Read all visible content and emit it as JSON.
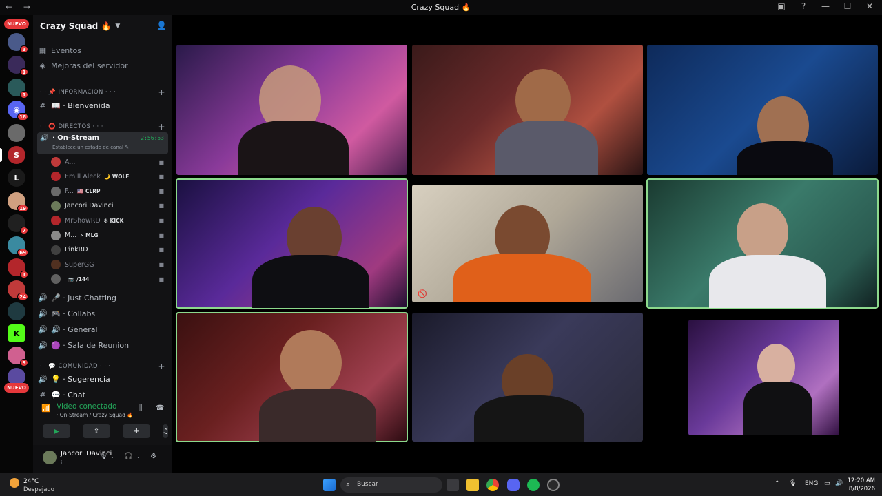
{
  "window": {
    "title": "Crazy Squad 🔥",
    "nav": "← →",
    "buttons": [
      "▣",
      "?",
      "—",
      "☐",
      "✕"
    ]
  },
  "rail": {
    "new_label_top": "NUEVO",
    "new_label_bottom": "NUEVO",
    "servers": [
      {
        "name": "server-1",
        "color": "#4a5a8a",
        "badge": "3"
      },
      {
        "name": "server-2",
        "color": "#3a2a5a",
        "badge": "1"
      },
      {
        "name": "server-3",
        "color": "#2a5a5a",
        "badge": "1"
      },
      {
        "name": "server-4",
        "color": "#5865f2",
        "badge": "18",
        "letter": "◉"
      },
      {
        "name": "server-5",
        "color": "#6a6a6a",
        "badge": ""
      },
      {
        "name": "server-6",
        "color": "#b3262b",
        "badge": "",
        "letter": "S"
      },
      {
        "name": "server-7",
        "color": "#1a1a1a",
        "badge": "",
        "letter": "L"
      },
      {
        "name": "server-8",
        "color": "#d0a080",
        "badge": "19"
      },
      {
        "name": "server-9",
        "color": "#202020",
        "badge": "7"
      },
      {
        "name": "server-10",
        "color": "#3a8aa0",
        "badge": "69"
      },
      {
        "name": "server-11",
        "color": "#b3262b",
        "badge": "1"
      },
      {
        "name": "server-12",
        "color": "#c03a3a",
        "badge": "24"
      },
      {
        "name": "server-13",
        "color": "#1f3a40",
        "badge": ""
      },
      {
        "name": "server-14",
        "color": "#53fc18",
        "badge": "",
        "letter": "K"
      },
      {
        "name": "server-15",
        "color": "#d06090",
        "badge": "9"
      },
      {
        "name": "server-16",
        "color": "#5a4aa0",
        "badge": ""
      }
    ]
  },
  "sidebar": {
    "server_name": "Crazy Squad 🔥",
    "top_items": [
      {
        "label": "Eventos",
        "icon": "▦"
      },
      {
        "label": "Mejoras del servidor",
        "icon": "◈"
      }
    ],
    "categories": {
      "info": "· · 📌 INFORMACION · · ·",
      "directos": "· · ⭕ DIRECTOS · · ·",
      "comunidad": "· · 💬 COMUNIDAD · · ·"
    },
    "bienvenida": "📖 · Bienvenida",
    "active_channel": {
      "name": "· On-Stream",
      "timer": "2:56:53",
      "status": "Establece un estado de canal ✎"
    },
    "users": [
      {
        "name": "A...",
        "tag": "",
        "color": "#c03a3a",
        "bright": false
      },
      {
        "name": "Emill Aleck",
        "tag": "🌙 WOLF",
        "color": "#b3262b",
        "bright": false
      },
      {
        "name": "F...",
        "tag": "🇺🇸 CLRP",
        "color": "#6a6a6a",
        "bright": false
      },
      {
        "name": "Jancori Davinci",
        "tag": "",
        "color": "#6b7a5a",
        "bright": true
      },
      {
        "name": "MrShowRD",
        "tag": "❇ KICK",
        "color": "#b3262b",
        "bright": false
      },
      {
        "name": "M...",
        "tag": "⚡ MLG",
        "color": "#8a8a8a",
        "bright": true
      },
      {
        "name": "PinkRD",
        "tag": "",
        "color": "#404040",
        "bright": true
      },
      {
        "name": "SuperGG",
        "tag": "",
        "color": "#503020",
        "bright": false
      },
      {
        "name": "",
        "tag": "📷 /144",
        "color": "#606060",
        "bright": true
      }
    ],
    "voice_channels": [
      {
        "label": "🎤 · Just Chatting"
      },
      {
        "label": "🎮 · Collabs"
      },
      {
        "label": "🔊 · General"
      },
      {
        "label": "🟣 · Sala de Reunion"
      }
    ],
    "community_channels": [
      {
        "label": "💡 · Sugerencia",
        "icon": "🔊"
      },
      {
        "label": "💬 · Chat",
        "icon": "#"
      }
    ]
  },
  "voice_panel": {
    "title": "Video conectado",
    "subtitle": "· On-Stream / Crazy Squad 🔥",
    "buttons": [
      "▶",
      "⇪",
      "✚",
      "♫"
    ]
  },
  "user_panel": {
    "name": "Jancori Davinci",
    "status": "i..."
  },
  "taskbar": {
    "temperature": "24°C",
    "weather": "Despejado",
    "search_placeholder": "Buscar",
    "language": "ENG",
    "time": "12:20 AM",
    "date": "8/8/2026"
  }
}
